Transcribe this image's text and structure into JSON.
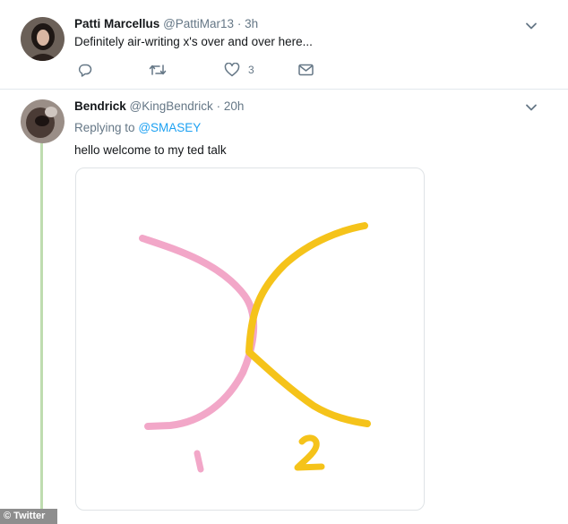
{
  "tweets": [
    {
      "author_name": "Patti Marcellus",
      "handle": "@PattiMar13",
      "separator": "·",
      "time": "3h",
      "text": "Definitely air-writing x's over and over here...",
      "actions": {
        "reply_icon": "reply-icon",
        "retweet_icon": "retweet-icon",
        "like_icon": "heart-icon",
        "like_count": "3",
        "dm_icon": "envelope-icon"
      }
    },
    {
      "author_name": "Bendrick",
      "handle": "@KingBendrick",
      "separator": "·",
      "time": "20h",
      "replying_prefix": "Replying to",
      "replying_to": "@SMASEY",
      "text": "hello welcome to my ted talk",
      "media": {
        "label_1": "1",
        "label_2": "2",
        "pink_color": "#f2a7c8",
        "yellow_color": "#f5c31a"
      }
    }
  ],
  "watermark": "© Twitter",
  "colors": {
    "link": "#1da1f2",
    "secondary_text": "#657786",
    "thread_line": "#bfdcb0"
  }
}
